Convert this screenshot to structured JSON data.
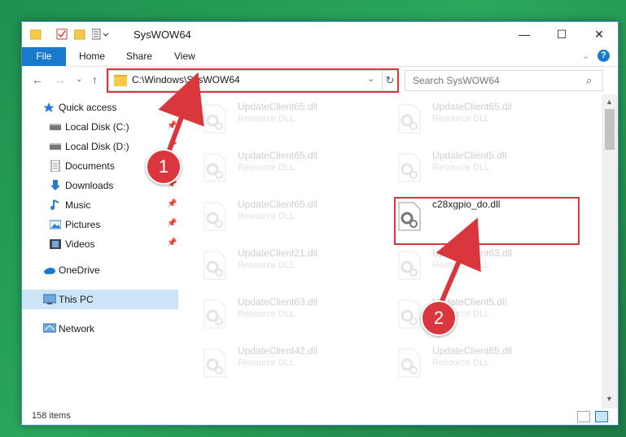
{
  "window": {
    "title": "SysWOW64"
  },
  "window_controls": {
    "minimize": "—",
    "maximize": "☐",
    "close": "✕"
  },
  "ribbon": {
    "tabs": [
      "File",
      "Home",
      "Share",
      "View"
    ],
    "expand_glyph": "⌄",
    "help_glyph": "?"
  },
  "nav": {
    "back_glyph": "←",
    "forward_glyph": "→",
    "recent_glyph": "⌄",
    "up_glyph": "↑",
    "address_path": "C:\\Windows\\SysWOW64",
    "address_dropdown_glyph": "⌄",
    "refresh_glyph": "↻",
    "search_placeholder": "Search SysWOW64",
    "search_glyph": "⌕"
  },
  "sidebar": {
    "items": [
      {
        "label": "Quick access",
        "icon": "star-icon",
        "pinned": false
      },
      {
        "label": "Local Disk (C:)",
        "icon": "drive-icon",
        "pinned": true
      },
      {
        "label": "Local Disk (D:)",
        "icon": "drive-icon",
        "pinned": true
      },
      {
        "label": "Documents",
        "icon": "documents-icon",
        "pinned": true
      },
      {
        "label": "Downloads",
        "icon": "download-icon",
        "pinned": true
      },
      {
        "label": "Music",
        "icon": "music-icon",
        "pinned": true
      },
      {
        "label": "Pictures",
        "icon": "pictures-icon",
        "pinned": true
      },
      {
        "label": "Videos",
        "icon": "videos-icon",
        "pinned": true
      },
      {
        "label": "OneDrive",
        "icon": "cloud-icon",
        "pinned": false
      },
      {
        "label": "This PC",
        "icon": "computer-icon",
        "pinned": false,
        "selected": true
      },
      {
        "label": "Network",
        "icon": "network-icon",
        "pinned": false
      }
    ],
    "pin_glyph": "📌"
  },
  "files": [
    {
      "name": "UpdateClient65.dll",
      "type": "Resource DLL"
    },
    {
      "name": "UpdateClient65.dll",
      "type": "Resource DLL"
    },
    {
      "name": "UpdateClient65.dll",
      "type": "Resource DLL"
    },
    {
      "name": "UpdateClient5.dll",
      "type": "Resource DLL"
    },
    {
      "name": "UpdateClient65.dll",
      "type": "Resource DLL"
    },
    {
      "name": "c28xgpio_do.dll",
      "type": ""
    },
    {
      "name": "UpdateClient21.dll",
      "type": "Resource DLL"
    },
    {
      "name": "UpdateClient63.dll",
      "type": "Resource DLL"
    },
    {
      "name": "UpdateClient63.dll",
      "type": "Resource DLL"
    },
    {
      "name": "UpdateClient5.dll",
      "type": "Resource DLL"
    },
    {
      "name": "UpdateClient42.dll",
      "type": "Resource DLL"
    },
    {
      "name": "UpdateClient65.dll",
      "type": "Resource DLL"
    }
  ],
  "status": {
    "item_count": "158 items"
  },
  "annotations": {
    "step1": "1",
    "step2": "2"
  },
  "colors": {
    "accent": "#1979ca",
    "annotation": "#d9363e",
    "selection": "#cce4f7",
    "desktop": "#2aa85c"
  }
}
